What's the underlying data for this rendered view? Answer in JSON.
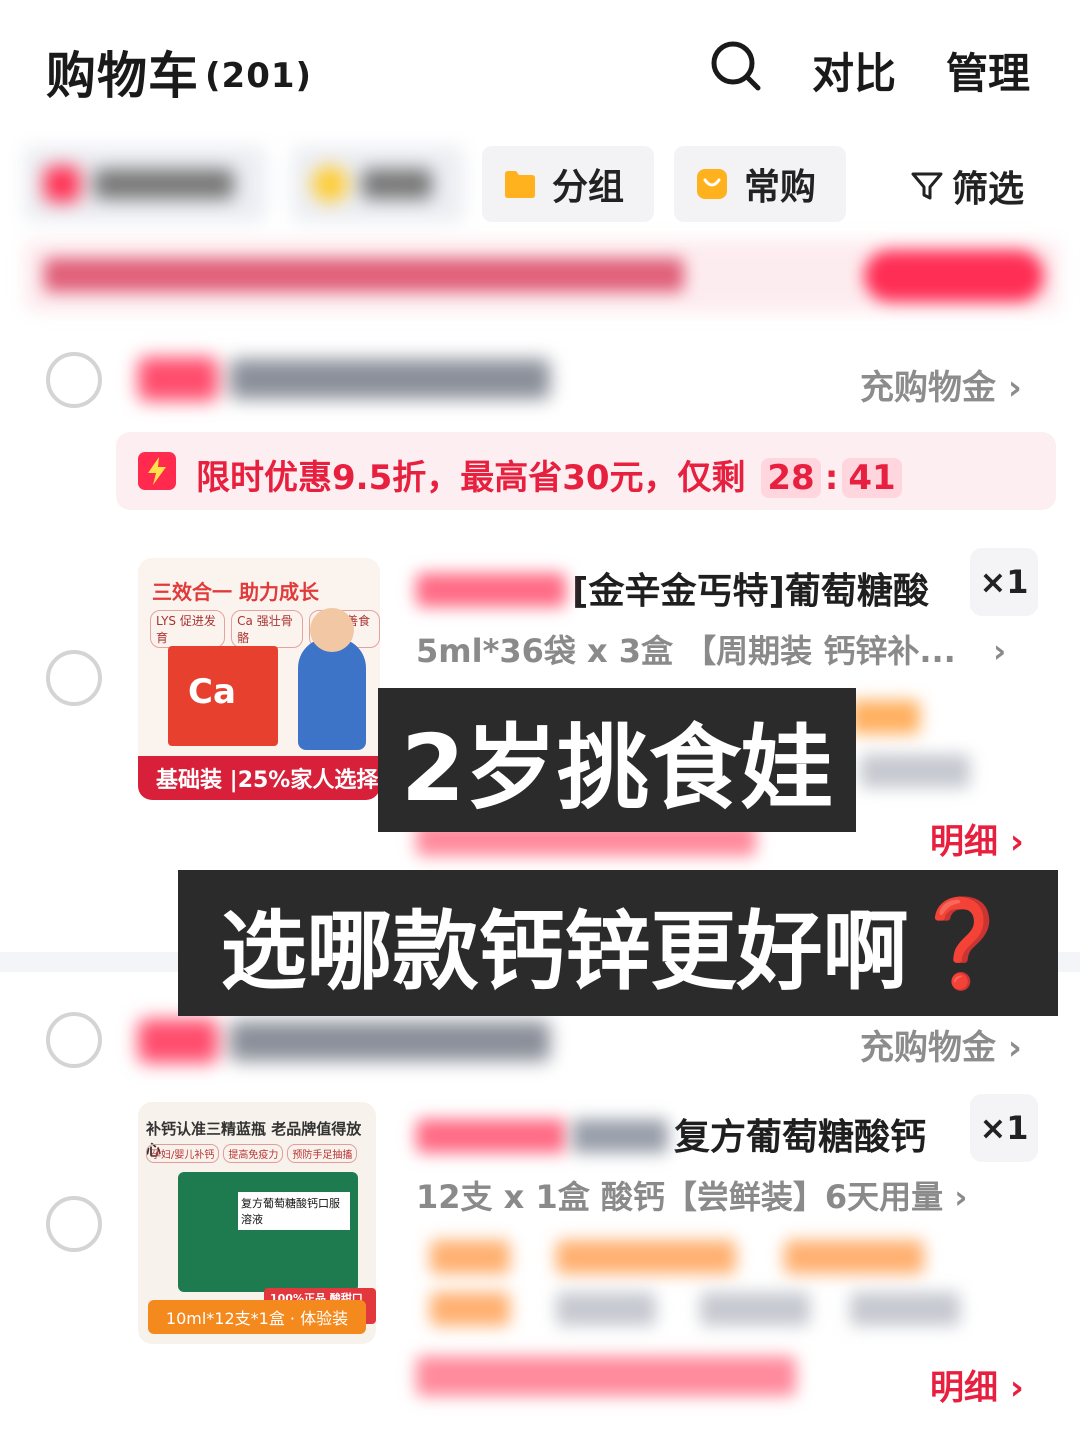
{
  "header": {
    "title": "购物车",
    "count": "(201)",
    "compare": "对比",
    "manage": "管理"
  },
  "filters": {
    "group": "分组",
    "frequent": "常购",
    "filter": "筛选"
  },
  "colors": {
    "accent": "#e8203f",
    "chip_orange": "#ffb21e"
  },
  "stores": [
    {
      "cashback": "充购物金",
      "flash": {
        "text": "限时优惠9.5折，最高省30元，仅剩",
        "hours": "28",
        "sep": ":",
        "minutes": "41"
      },
      "product": {
        "title": "[金辛金丐特]葡萄糖酸",
        "qty": "×1",
        "spec": "5ml*36袋 x 3盒 【周期装 钙锌补...",
        "detail": "明细",
        "image": {
          "headline": "三效合一 助力成长",
          "pills": [
            "LYS 促进发育",
            "Ca 强壮骨骼",
            "Zn 改善食欲"
          ],
          "ca": "Ca",
          "band": "基础装 |25%家人选择"
        }
      }
    },
    {
      "cashback": "充购物金",
      "product": {
        "title": "复方葡萄糖酸钙",
        "qty": "×1",
        "spec": "12支 x 1盒 酸钙【尝鲜装】6天用量",
        "detail": "明细",
        "image": {
          "headline": "补钙认准三精蓝瓶 老品牌值得放心",
          "pills": [
            "孕妇/婴儿补钙",
            "提高免疫力",
            "预防手足抽搐"
          ],
          "label": "复方葡萄糖酸钙口服溶液",
          "badge": "100%正品 酸甜口味",
          "band": "10ml*12支*1盒 · 体验装"
        }
      }
    }
  ],
  "overlay": {
    "line1": "2岁挑食娃",
    "line2": "选哪款钙锌更好啊",
    "qmark": "❓"
  }
}
